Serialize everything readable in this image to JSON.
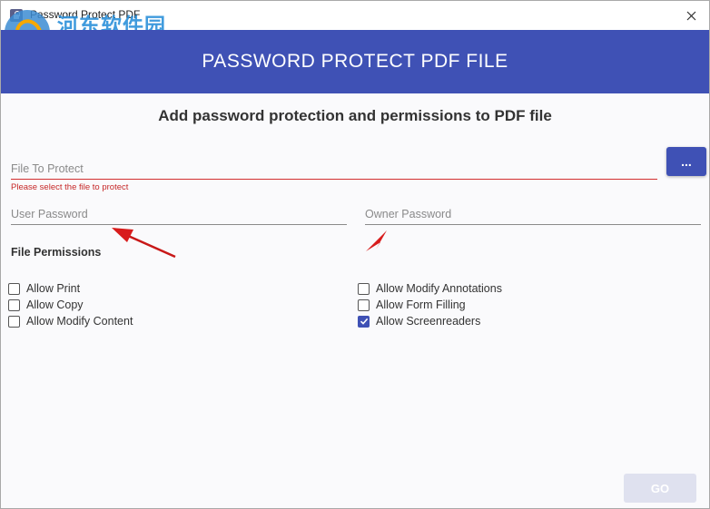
{
  "window": {
    "title": "Password Protect PDF",
    "close_glyph": "✕"
  },
  "watermark": {
    "text": "河东软件园",
    "url": "www.pc0359.cn"
  },
  "header": {
    "title": "PASSWORD PROTECT PDF FILE",
    "accent_color": "#3f51b5"
  },
  "subtitle": "Add password protection and permissions to PDF file",
  "file_field": {
    "placeholder": "File To Protect",
    "value": "",
    "error": "Please select the file to protect"
  },
  "browse_button": {
    "label": "..."
  },
  "user_password": {
    "placeholder": "User Password",
    "value": ""
  },
  "owner_password": {
    "placeholder": "Owner Password",
    "value": ""
  },
  "permissions": {
    "heading": "File Permissions",
    "left": [
      {
        "label": "Allow Print",
        "checked": false
      },
      {
        "label": "Allow Copy",
        "checked": false
      },
      {
        "label": "Allow Modify Content",
        "checked": false
      }
    ],
    "right": [
      {
        "label": "Allow Modify Annotations",
        "checked": false
      },
      {
        "label": "Allow Form Filling",
        "checked": false
      },
      {
        "label": "Allow Screenreaders",
        "checked": true
      }
    ]
  },
  "go_button": {
    "label": "GO",
    "enabled": false
  },
  "annotation_color": "#e02020"
}
